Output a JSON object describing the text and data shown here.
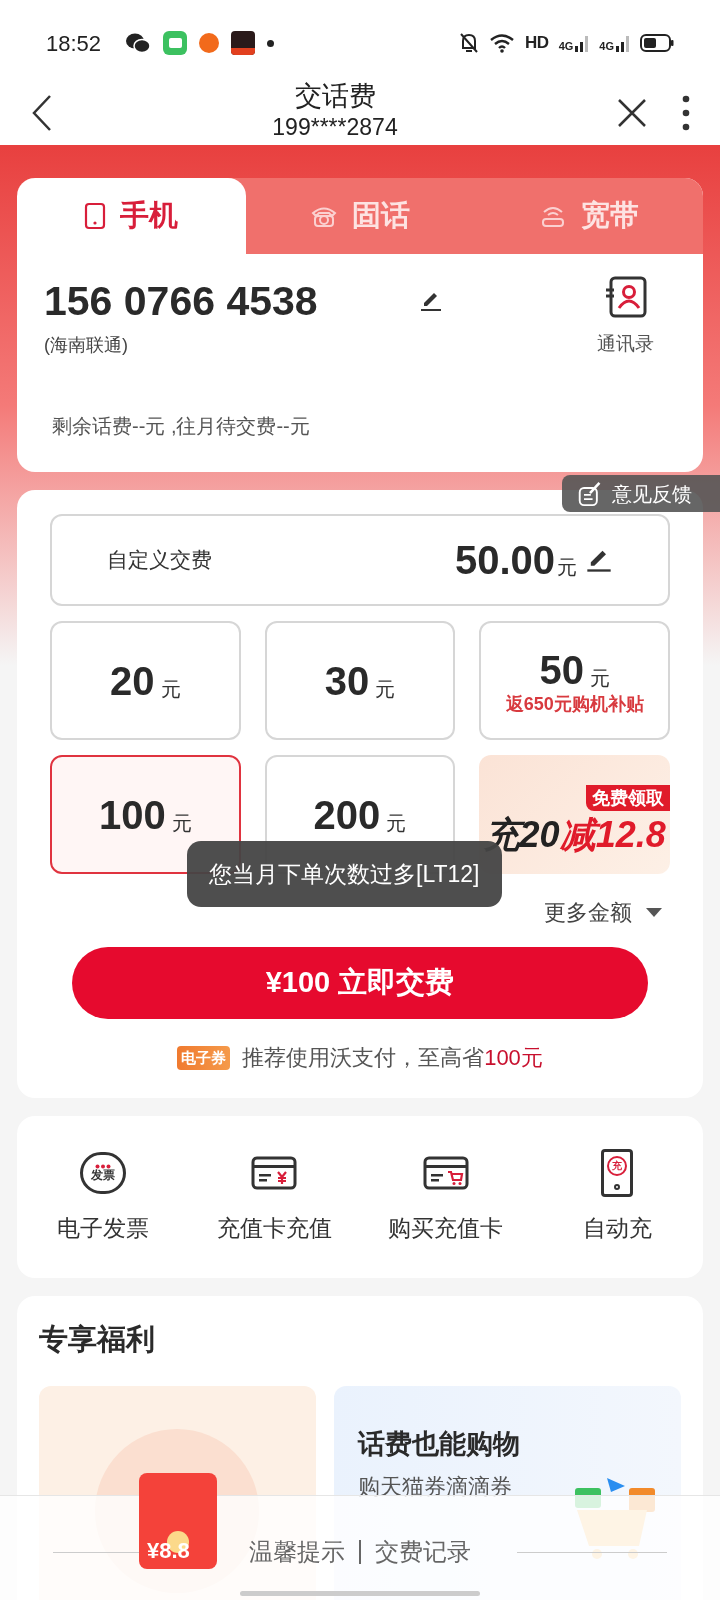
{
  "status_bar": {
    "time": "18:52",
    "network_labels": [
      "4G",
      "4G"
    ],
    "hd_label": "HD"
  },
  "header": {
    "title": "交话费",
    "subtitle": "199****2874"
  },
  "tabs": [
    {
      "label": "手机",
      "selected": true,
      "kind": "mobile"
    },
    {
      "label": "固话",
      "selected": false,
      "kind": "landline"
    },
    {
      "label": "宽带",
      "selected": false,
      "kind": "broadband"
    }
  ],
  "account": {
    "number": "156 0766 4538",
    "carrier": "(海南联通)",
    "contacts_label": "通讯录",
    "balance": "剩余话费--元 ,往月待交费--元"
  },
  "custom_amount": {
    "label": "自定义交费",
    "value": "50.00",
    "unit": "元"
  },
  "amounts": [
    {
      "value": "20",
      "unit": "元",
      "selected": false
    },
    {
      "value": "30",
      "unit": "元",
      "selected": false
    },
    {
      "value": "50",
      "unit": "元",
      "note": "返650元购机补贴",
      "selected": false
    },
    {
      "value": "100",
      "unit": "元",
      "selected": true
    },
    {
      "value": "200",
      "unit": "元",
      "selected": false
    }
  ],
  "promo": {
    "badge": "免费领取",
    "text_a": "充20",
    "text_b": "减12.8"
  },
  "more_amounts": "更多金额",
  "pay_button": "¥100 立即交费",
  "tip": {
    "badge": "电子券",
    "text": "推荐使用沃支付，至高省",
    "highlight": "100元"
  },
  "services": [
    {
      "label": "电子发票",
      "kind": "invoice",
      "icon_text": "发票"
    },
    {
      "label": "充值卡充值",
      "kind": "card_yuan"
    },
    {
      "label": "购买充值卡",
      "kind": "card_cart"
    },
    {
      "label": "自动充",
      "kind": "auto",
      "icon_text": "充"
    }
  ],
  "benefits": {
    "title": "专享福利",
    "envelope_amount": "¥8.8",
    "card_title": "话费也能购物",
    "card_subtitle": "购天猫券滴滴券"
  },
  "footer_links": [
    "温馨提示",
    "交费记录"
  ],
  "toast": "您当月下单次数过多[LT12]",
  "feedback": "意见反馈"
}
